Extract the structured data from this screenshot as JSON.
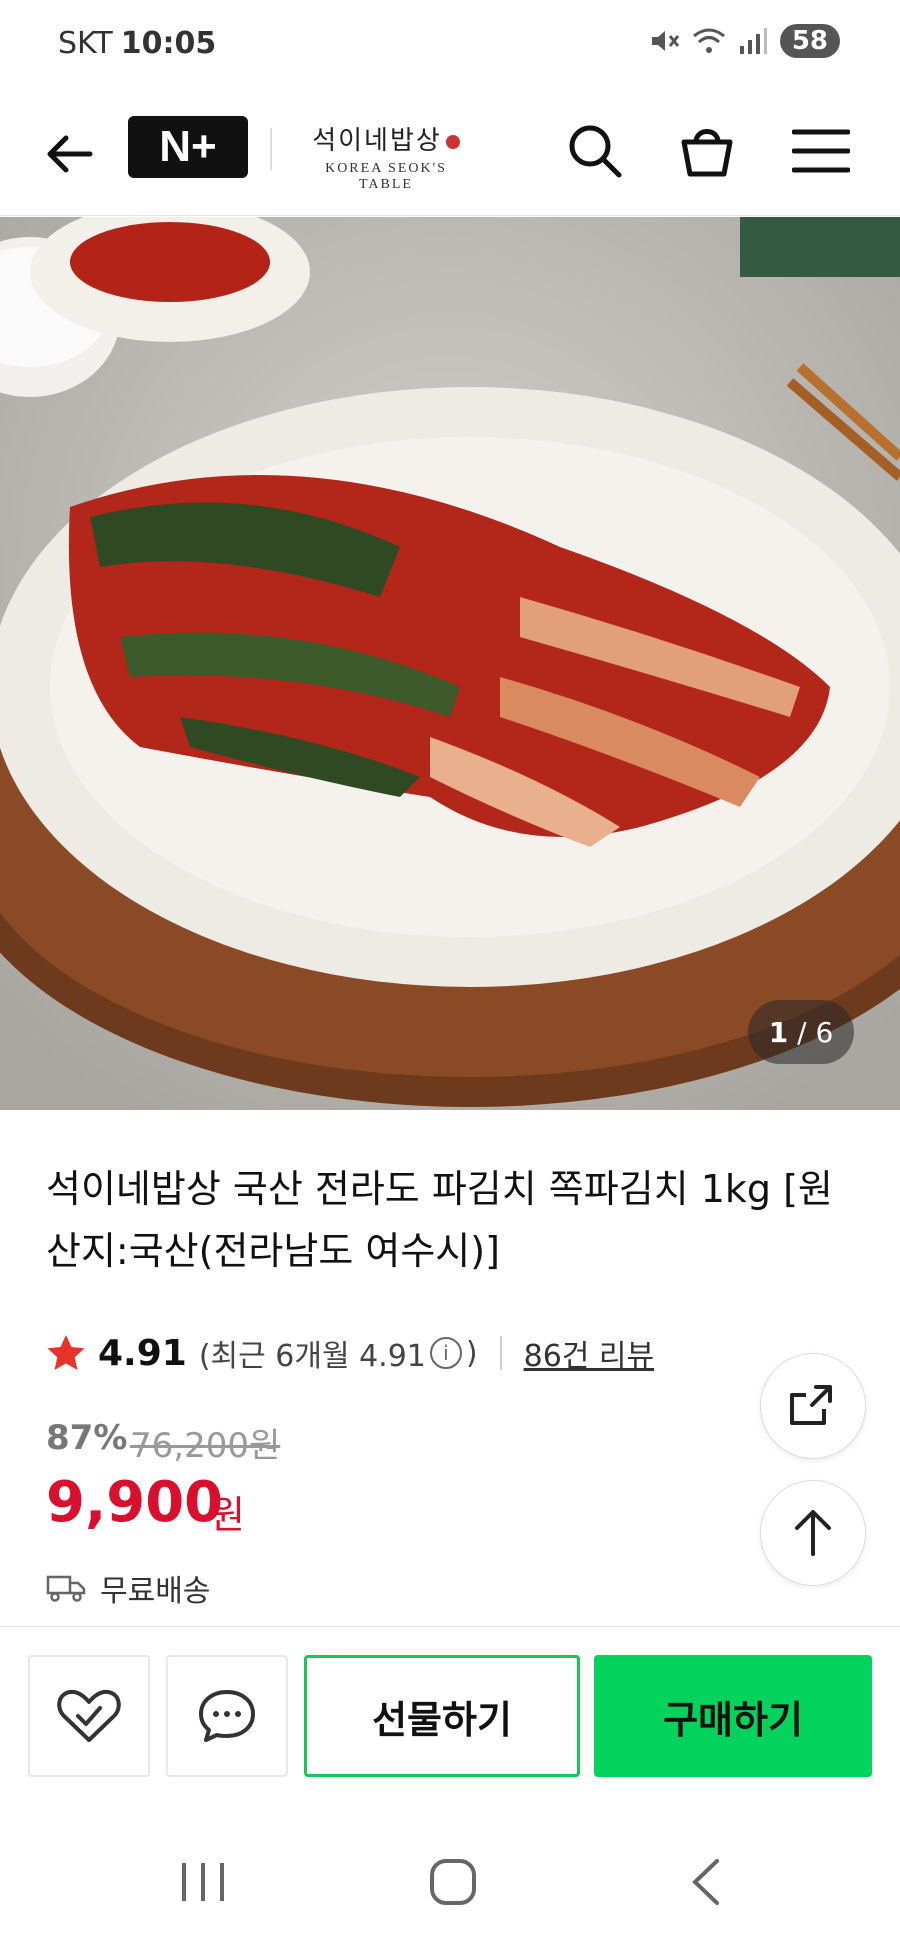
{
  "status_bar": {
    "carrier": "SKT",
    "time": "10:05",
    "battery": "58",
    "signal": "5"
  },
  "header": {
    "brand_mark": "N+",
    "store_name_kr": "석이네밥상",
    "store_name_en": "KOREA SEOK'S TABLE",
    "icons": [
      "back-arrow-icon",
      "search-icon",
      "cart-icon",
      "menu-icon"
    ]
  },
  "gallery": {
    "current": "1",
    "total": "/ 6"
  },
  "product": {
    "title": "석이네밥상 국산 전라도 파김치 쪽파김치 1kg [원산지:국산(전라남도 여수시)]",
    "rating": "4.91",
    "recent_rating_prefix": "(최근 6개월 4.91",
    "recent_rating_suffix": ")",
    "review_count": "86건 리뷰",
    "discount": "87%",
    "original_price": "76,200원",
    "price": "9,900",
    "price_unit": "원",
    "shipping": "무료배송"
  },
  "actions": {
    "gift": "선물하기",
    "buy": "구매하기"
  },
  "colors": {
    "accent_green": "#03d25c",
    "price_red": "#d80f2d",
    "star": "#e8322a"
  }
}
